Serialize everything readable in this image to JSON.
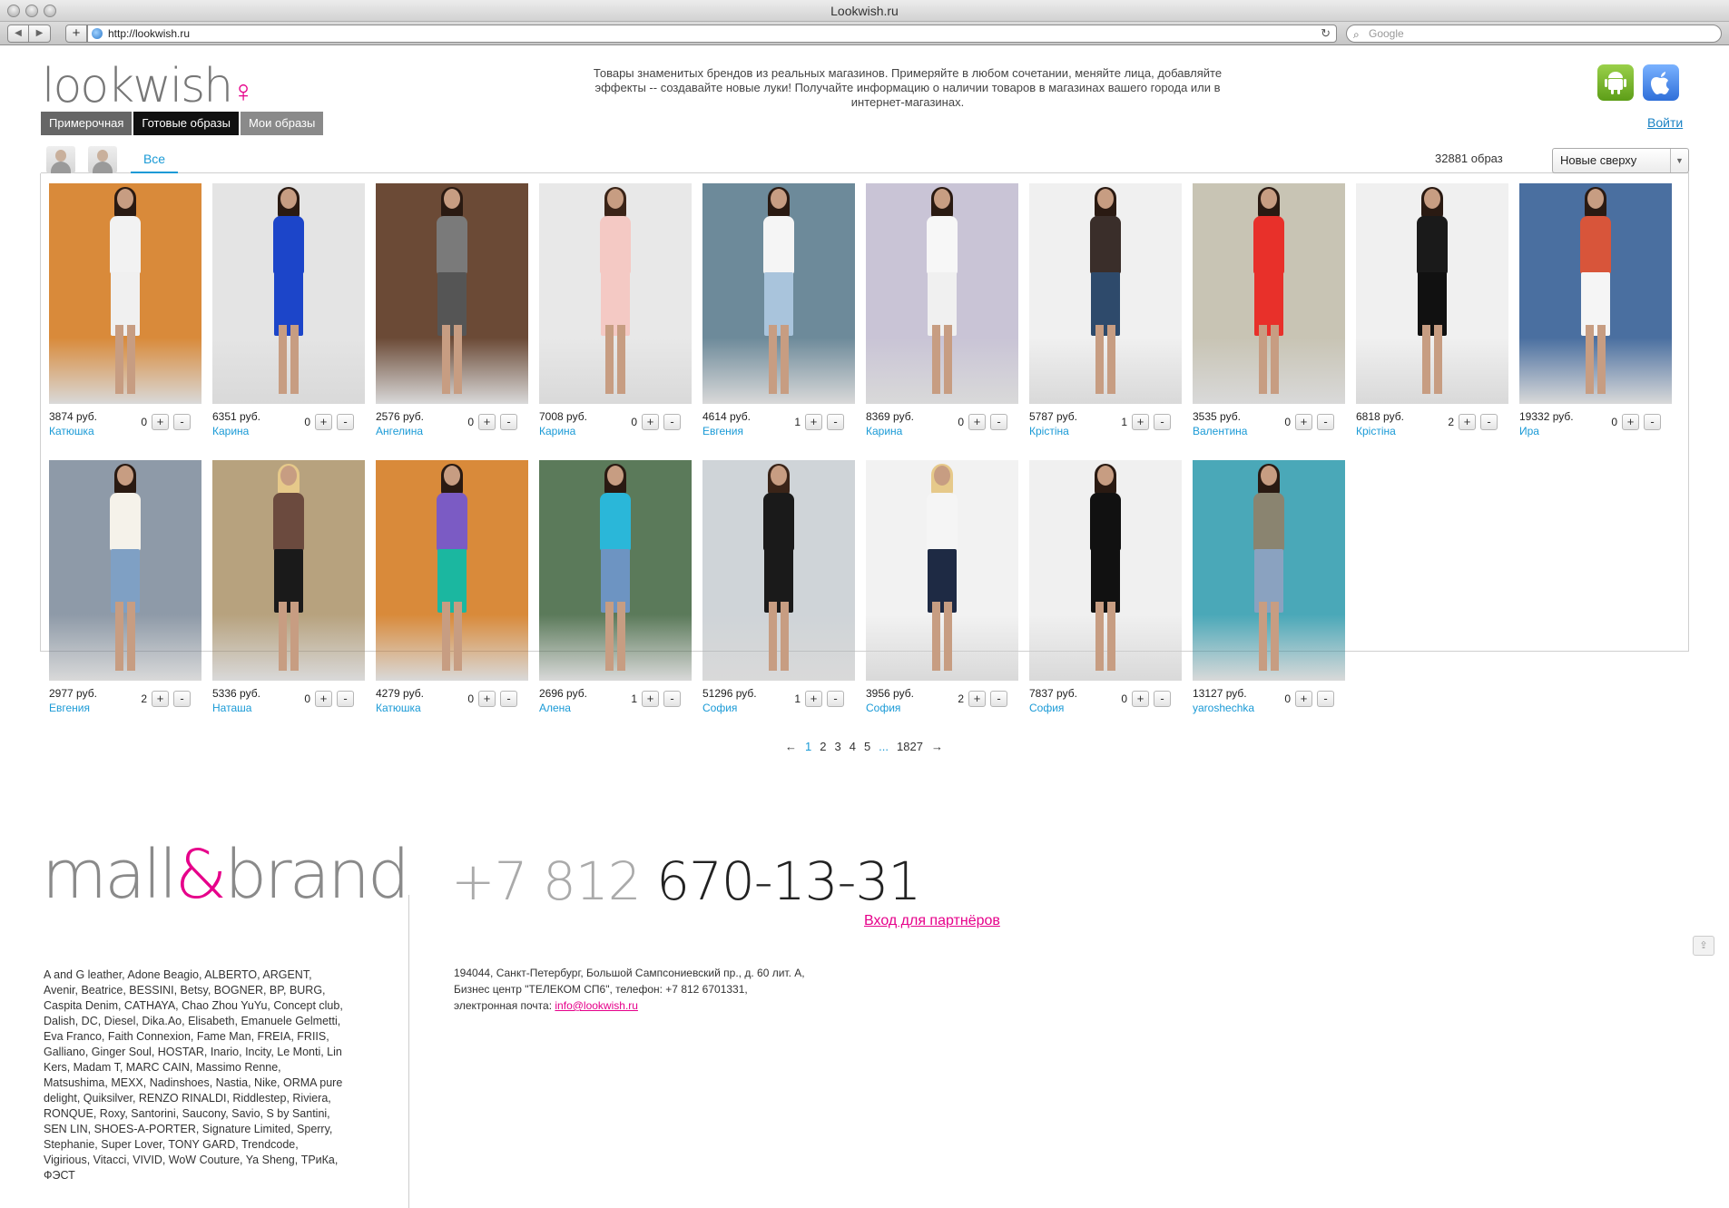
{
  "browser": {
    "window_title": "Lookwish.ru",
    "url": "http://lookwish.ru",
    "search_placeholder": "Google"
  },
  "header": {
    "logo_text": "lookwish",
    "tagline": "Товары знаменитых брендов из реальных магазинов. Примеряйте в любом сочетании, меняйте лица, добавляйте эффекты -- создавайте новые луки! Получайте информацию о наличии товаров в магазинах вашего города или в интернет-магазинах.",
    "tabs": [
      {
        "label": "Примерочная"
      },
      {
        "label": "Готовые образы"
      },
      {
        "label": "Мои образы"
      }
    ],
    "login_label": "Войти"
  },
  "filters": {
    "all_tab": "Все",
    "count_text": "32881 образ",
    "sort_value": "Новые сверху"
  },
  "looks": [
    {
      "price": "3874 руб.",
      "owner": "Катюшка",
      "votes": "0",
      "bg": "#d98a3a",
      "top": "#f2f2f2",
      "bottom": "#f0f0f0",
      "hair": "#2a1a12"
    },
    {
      "price": "6351 руб.",
      "owner": "Карина",
      "votes": "0",
      "bg": "#e4e4e4",
      "top": "#1c45c9",
      "bottom": "#1c45c9",
      "hair": "#2a1a12"
    },
    {
      "price": "2576 руб.",
      "owner": "Ангелина",
      "votes": "0",
      "bg": "#6b4a36",
      "top": "#7a7a7a",
      "bottom": "#555555",
      "hair": "#2a1a12"
    },
    {
      "price": "7008 руб.",
      "owner": "Карина",
      "votes": "0",
      "bg": "#e8e8e8",
      "top": "#f4c9c4",
      "bottom": "#f4c9c4",
      "hair": "#3a2418"
    },
    {
      "price": "4614 руб.",
      "owner": "Евгения",
      "votes": "1",
      "bg": "#6d8a9a",
      "top": "#f5f5f5",
      "bottom": "#a9c4dc",
      "hair": "#2a1a12"
    },
    {
      "price": "8369 руб.",
      "owner": "Карина",
      "votes": "0",
      "bg": "#c9c4d6",
      "top": "#f7f7f7",
      "bottom": "#f0f0f0",
      "hair": "#2a1a12"
    },
    {
      "price": "5787 руб.",
      "owner": "Крістіна",
      "votes": "1",
      "bg": "#f0f0f0",
      "top": "#3a2e2a",
      "bottom": "#2e4a6b",
      "hair": "#2a1a12"
    },
    {
      "price": "3535 руб.",
      "owner": "Валентина",
      "votes": "0",
      "bg": "#c8c4b4",
      "top": "#e8302a",
      "bottom": "#e8302a",
      "hair": "#2a1a12"
    },
    {
      "price": "6818 руб.",
      "owner": "Крістіна",
      "votes": "2",
      "bg": "#f0f0f0",
      "top": "#1a1a1a",
      "bottom": "#111111",
      "hair": "#2a1a12"
    },
    {
      "price": "19332 руб.",
      "owner": "Ира",
      "votes": "0",
      "bg": "#4a6fa0",
      "top": "#d8553a",
      "bottom": "#f5f5f5",
      "hair": "#2a1a12"
    },
    {
      "price": "2977 руб.",
      "owner": "Евгения",
      "votes": "2",
      "bg": "#8e9aa8",
      "top": "#f5f2ea",
      "bottom": "#7fa0c4",
      "hair": "#2a1a12"
    },
    {
      "price": "5336 руб.",
      "owner": "Наташа",
      "votes": "0",
      "bg": "#b7a27e",
      "top": "#6b4a3e",
      "bottom": "#1a1a1a",
      "hair": "#e6c98a"
    },
    {
      "price": "4279 руб.",
      "owner": "Катюшка",
      "votes": "0",
      "bg": "#d98a3a",
      "top": "#7b5bc4",
      "bottom": "#1bb7a0",
      "hair": "#2a1a12"
    },
    {
      "price": "2696 руб.",
      "owner": "Алена",
      "votes": "1",
      "bg": "#5b7a5a",
      "top": "#2ab7d9",
      "bottom": "#6d94c2",
      "hair": "#2a1a12"
    },
    {
      "price": "51296 руб.",
      "owner": "София",
      "votes": "1",
      "bg": "#cfd4d8",
      "top": "#1a1a1a",
      "bottom": "#1a1a1a",
      "hair": "#3a2418"
    },
    {
      "price": "3956 руб.",
      "owner": "София",
      "votes": "2",
      "bg": "#f2f2f2",
      "top": "#f5f5f5",
      "bottom": "#1e2a44",
      "hair": "#e6c98a"
    },
    {
      "price": "7837 руб.",
      "owner": "София",
      "votes": "0",
      "bg": "#f0f0f0",
      "top": "#111111",
      "bottom": "#111111",
      "hair": "#2a1a12"
    },
    {
      "price": "13127 руб.",
      "owner": "yaroshechka",
      "votes": "0",
      "bg": "#4aa8b8",
      "top": "#8a8470",
      "bottom": "#8aa2c0",
      "hair": "#2a1a12"
    }
  ],
  "pagination": {
    "prev": "←",
    "pages": [
      "1",
      "2",
      "3",
      "4",
      "5"
    ],
    "ellipsis": "...",
    "last": "1827",
    "next": "→"
  },
  "footer": {
    "mall_logo_a": "mall",
    "mall_logo_amp": "&",
    "mall_logo_b": "brand",
    "phone_prefix": "+7 812",
    "phone_main": "670-13-31",
    "partners_link": "Вход для партнёров",
    "address_line1": "194044, Санкт-Петербург, Большой Сампсониевский пр., д. 60 лит. А,",
    "address_line2": "Бизнес центр \"ТЕЛЕКОМ СП6\", телефон: +7 812 6701331,",
    "email_label": "электронная почта: ",
    "email": "info@lookwish.ru",
    "brands": "A and G leather, Adone Beagio, ALBERTO, ARGENT, Avenir, Beatrice, BESSINI, Betsy, BOGNER, BP, BURG, Caspita Denim, CATHAYA, Chao Zhou YuYu, Concept club, Dalish, DC, Diesel, Dika.Ao, Elisabeth, Emanuele Gelmetti, Eva Franco, Faith Connexion, Fame Man, FREIA, FRIIS, Galliano, Ginger Soul, HOSTAR, Inario, Incity, Le Monti, Lin Kers, Madam T, MARC CAIN, Massimo Renne, Matsushima, MEXX, Nadinshoes, Nastia, Nike, ORMA pure delight, Quiksilver, RENZO RINALDI, Riddlestep, Riviera, RONQUE, Roxy, Santorini, Saucony, Savio, S by Santini, SEN LIN, SHOES-A-PORTER, Signature Limited, Sperry, Stephanie, Super Lover, TONY GARD, Trendcode, Vigirious, Vitacci, VIVID, WoW Couture, Ya Sheng, ТРиКа, ФЭСТ"
  }
}
